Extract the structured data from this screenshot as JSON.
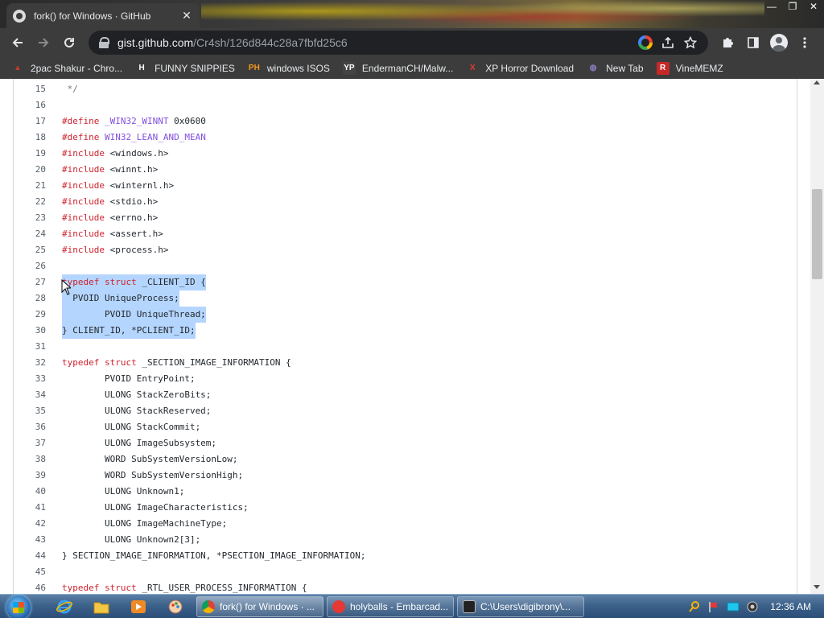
{
  "browser": {
    "tab_title": "fork() for Windows · GitHub",
    "tab_close": "✕",
    "window_controls": [
      "—",
      "❐",
      "✕"
    ],
    "url_host": "gist.github.com",
    "url_path": "/Cr4sh/126d844c28a7fbfd25c6"
  },
  "bookmarks": [
    {
      "label": "2pac Shakur - Chro...",
      "icon": "2pac-icon",
      "color": "#c0392b",
      "glyph": "▲"
    },
    {
      "label": "FUNNY SNIPPIES",
      "icon": "h-logo-icon",
      "color": "#ffffff",
      "glyph": "H"
    },
    {
      "label": "windows ISOS",
      "icon": "ph-logo-icon",
      "color": "#f7971d",
      "glyph": "PH"
    },
    {
      "label": "EndermanCH/Malw...",
      "icon": "yp-logo-icon",
      "color": "#444444",
      "glyph": "YP"
    },
    {
      "label": "XP Horror Download",
      "icon": "x-logo-icon",
      "color": "#e53935",
      "glyph": "X"
    },
    {
      "label": "New Tab",
      "icon": "globe-icon",
      "color": "#8e7cc3",
      "glyph": "◍"
    },
    {
      "label": "VineMEMZ",
      "icon": "r-logo-icon",
      "color": "#c62828",
      "glyph": "R"
    }
  ],
  "code": {
    "lines": [
      {
        "n": "15",
        "tokens": [
          {
            "t": " */",
            "c": "cm"
          }
        ]
      },
      {
        "n": "16",
        "tokens": []
      },
      {
        "n": "17",
        "tokens": [
          {
            "t": "#define",
            "c": "kw"
          },
          {
            "t": " ",
            "c": ""
          },
          {
            "t": "_WIN32_WINNT",
            "c": "pp"
          },
          {
            "t": " 0x0600",
            "c": ""
          }
        ]
      },
      {
        "n": "18",
        "tokens": [
          {
            "t": "#define",
            "c": "kw"
          },
          {
            "t": " ",
            "c": ""
          },
          {
            "t": "WIN32_LEAN_AND_MEAN",
            "c": "pp"
          }
        ]
      },
      {
        "n": "19",
        "tokens": [
          {
            "t": "#include",
            "c": "kw"
          },
          {
            "t": " <windows.h>",
            "c": ""
          }
        ]
      },
      {
        "n": "20",
        "tokens": [
          {
            "t": "#include",
            "c": "kw"
          },
          {
            "t": " <winnt.h>",
            "c": ""
          }
        ]
      },
      {
        "n": "21",
        "tokens": [
          {
            "t": "#include",
            "c": "kw"
          },
          {
            "t": " <winternl.h>",
            "c": ""
          }
        ]
      },
      {
        "n": "22",
        "tokens": [
          {
            "t": "#include",
            "c": "kw"
          },
          {
            "t": " <stdio.h>",
            "c": ""
          }
        ]
      },
      {
        "n": "23",
        "tokens": [
          {
            "t": "#include",
            "c": "kw"
          },
          {
            "t": " <errno.h>",
            "c": ""
          }
        ]
      },
      {
        "n": "24",
        "tokens": [
          {
            "t": "#include",
            "c": "kw"
          },
          {
            "t": " <assert.h>",
            "c": ""
          }
        ]
      },
      {
        "n": "25",
        "tokens": [
          {
            "t": "#include",
            "c": "kw"
          },
          {
            "t": " <process.h>",
            "c": ""
          }
        ]
      },
      {
        "n": "26",
        "tokens": []
      },
      {
        "n": "27",
        "sel": true,
        "tokens": [
          {
            "t": "typedef",
            "c": "kw"
          },
          {
            "t": " ",
            "c": ""
          },
          {
            "t": "struct",
            "c": "kw"
          },
          {
            "t": " _CLIENT_ID {",
            "c": ""
          }
        ]
      },
      {
        "n": "28",
        "sel": true,
        "tokens": [
          {
            "t": "  PVOID UniqueProcess;",
            "c": ""
          }
        ]
      },
      {
        "n": "29",
        "sel": true,
        "tokens": [
          {
            "t": "        PVOID UniqueThread;",
            "c": ""
          }
        ]
      },
      {
        "n": "30",
        "sel": true,
        "tokens": [
          {
            "t": "} CLIENT_ID, *PCLIENT_ID;",
            "c": ""
          }
        ]
      },
      {
        "n": "31",
        "tokens": []
      },
      {
        "n": "32",
        "tokens": [
          {
            "t": "typedef",
            "c": "kw"
          },
          {
            "t": " ",
            "c": ""
          },
          {
            "t": "struct",
            "c": "kw"
          },
          {
            "t": " _SECTION_IMAGE_INFORMATION {",
            "c": ""
          }
        ]
      },
      {
        "n": "33",
        "tokens": [
          {
            "t": "        PVOID EntryPoint;",
            "c": ""
          }
        ]
      },
      {
        "n": "34",
        "tokens": [
          {
            "t": "        ULONG StackZeroBits;",
            "c": ""
          }
        ]
      },
      {
        "n": "35",
        "tokens": [
          {
            "t": "        ULONG StackReserved;",
            "c": ""
          }
        ]
      },
      {
        "n": "36",
        "tokens": [
          {
            "t": "        ULONG StackCommit;",
            "c": ""
          }
        ]
      },
      {
        "n": "37",
        "tokens": [
          {
            "t": "        ULONG ImageSubsystem;",
            "c": ""
          }
        ]
      },
      {
        "n": "38",
        "tokens": [
          {
            "t": "        WORD SubSystemVersionLow;",
            "c": ""
          }
        ]
      },
      {
        "n": "39",
        "tokens": [
          {
            "t": "        WORD SubSystemVersionHigh;",
            "c": ""
          }
        ]
      },
      {
        "n": "40",
        "tokens": [
          {
            "t": "        ULONG Unknown1;",
            "c": ""
          }
        ]
      },
      {
        "n": "41",
        "tokens": [
          {
            "t": "        ULONG ImageCharacteristics;",
            "c": ""
          }
        ]
      },
      {
        "n": "42",
        "tokens": [
          {
            "t": "        ULONG ImageMachineType;",
            "c": ""
          }
        ]
      },
      {
        "n": "43",
        "tokens": [
          {
            "t": "        ULONG Unknown2[3];",
            "c": ""
          }
        ]
      },
      {
        "n": "44",
        "tokens": [
          {
            "t": "} SECTION_IMAGE_INFORMATION, *PSECTION_IMAGE_INFORMATION;",
            "c": ""
          }
        ]
      },
      {
        "n": "45",
        "tokens": []
      },
      {
        "n": "46",
        "tokens": [
          {
            "t": "typedef",
            "c": "kw"
          },
          {
            "t": " ",
            "c": ""
          },
          {
            "t": "struct",
            "c": "kw"
          },
          {
            "t": " _RTL_USER_PROCESS_INFORMATION {",
            "c": ""
          }
        ]
      }
    ]
  },
  "taskbar": {
    "tasks": [
      {
        "label": "fork() for Windows · ...",
        "icon": "chrome-icon",
        "color": "#db4437",
        "active": true
      },
      {
        "label": "holyballs - Embarcad...",
        "icon": "dev-cpp-icon",
        "color": "#e53935",
        "active": false
      },
      {
        "label": "C:\\Users\\digibrony\\...",
        "icon": "cmd-icon",
        "color": "#222222",
        "active": false
      }
    ],
    "clock": "12:36 AM"
  }
}
